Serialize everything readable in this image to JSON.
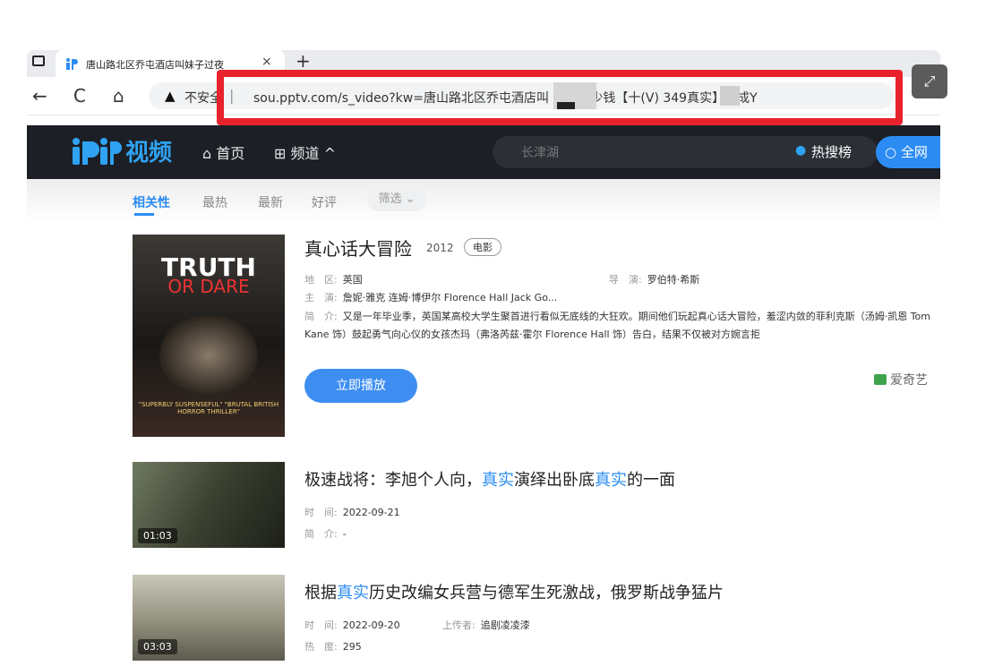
{
  "browser": {
    "tab_title": "唐山路北区乔屯酒店叫妹子过夜",
    "tab_close": "×",
    "new_tab": "+",
    "back": "←",
    "reload": "C",
    "home": "⌂",
    "security_warning": "不安全",
    "url": "sou.pptv.com/s_video?kw=唐山路北区乔屯酒店叫    服务多少钱【十(V)    349真实】同成Y",
    "expand": "⤢"
  },
  "site": {
    "logo": "视频",
    "nav": {
      "home": "首页",
      "channel": "频道"
    },
    "search": {
      "placeholder": "长津湖",
      "hot_label": "热搜榜",
      "search_button": "全网"
    }
  },
  "filters": {
    "tabs": [
      "相关性",
      "最热",
      "最新",
      "好评"
    ],
    "active_tab": "相关性",
    "filter_button": "筛选"
  },
  "results": {
    "main": {
      "title": "真心话大冒险",
      "year": "2012",
      "type_tag": "电影",
      "region_label": "地　区:",
      "region": "英国",
      "director_label": "导　演:",
      "director": "罗伯特·希斯",
      "cast_label": "主　演:",
      "cast": "詹妮·雅克  连姆·博伊尔  Florence Hall  Jack Go...",
      "intro_label": "简　介:",
      "intro": "又是一年毕业季，英国某高校大学生聚首进行看似无底线的大狂欢。期间他们玩起真心话大冒险，羞涩内敛的菲利克斯（汤姆·凯恩 Tom Kane 饰）鼓起勇气向心仪的女孩杰玛（弗洛芮兹·霍尔 Florence Hall 饰）告白，结果不仅被对方婉言拒",
      "play_button": "立即播放",
      "source": "爱奇艺",
      "poster_title1": "TRUTH",
      "poster_title2": "OR DARE",
      "poster_quote": "\"SUPERBLY SUSPENSEFUL\" \"BRUTAL BRITISH HORROR THRILLER\""
    },
    "video1": {
      "duration": "01:03",
      "title_a": "极速战将：李旭个人向，",
      "title_hl1": "真实",
      "title_b": "演绎出卧底",
      "title_hl2": "真实",
      "title_c": "的一面",
      "time_label": "时　间:",
      "time": "2022-09-21",
      "intro_label": "简　介:",
      "intro": "-"
    },
    "video2": {
      "duration": "03:03",
      "title_a": "根据",
      "title_hl1": "真实",
      "title_b": "历史改编女兵营与德军生死激战，俄罗斯战争猛片",
      "time_label": "时　间:",
      "time": "2022-09-20",
      "uploader_label": "上传者:",
      "uploader": "追剧凌凌漆",
      "heat_label": "热　度:",
      "heat": "295"
    }
  },
  "colors": {
    "accent": "#2c8cf4",
    "highlight_box": "#e8222d",
    "header_bg": "#1c1f26"
  }
}
